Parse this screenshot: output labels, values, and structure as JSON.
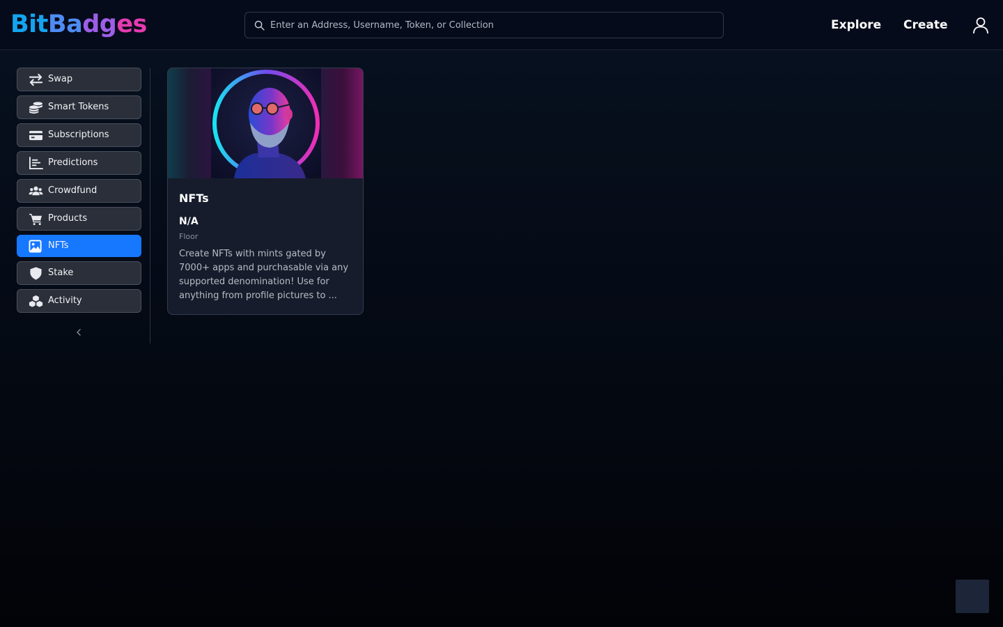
{
  "header": {
    "logo": {
      "part1": "Bit",
      "part2": "Ba",
      "part3": "dg",
      "part4": "es"
    },
    "search": {
      "placeholder": "Enter an Address, Username, Token, or Collection",
      "value": "",
      "icon": "search-icon"
    },
    "nav": {
      "explore": "Explore",
      "create": "Create"
    },
    "user_icon": "user-icon"
  },
  "sidebar": {
    "items": [
      {
        "label": "Swap",
        "icon": "swap-icon",
        "active": false
      },
      {
        "label": "Smart Tokens",
        "icon": "coins-icon",
        "active": false
      },
      {
        "label": "Subscriptions",
        "icon": "credit-card-icon",
        "active": false
      },
      {
        "label": "Predictions",
        "icon": "bar-chart-icon",
        "active": false
      },
      {
        "label": "Crowdfund",
        "icon": "users-icon",
        "active": false
      },
      {
        "label": "Products",
        "icon": "cart-icon",
        "active": false
      },
      {
        "label": "NFTs",
        "icon": "image-icon",
        "active": true
      },
      {
        "label": "Stake",
        "icon": "shield-icon",
        "active": false
      },
      {
        "label": "Activity",
        "icon": "cubes-icon",
        "active": false
      }
    ],
    "collapse_icon": "chevron-left-icon"
  },
  "card": {
    "title": "NFTs",
    "value": "N/A",
    "value_label": "Floor",
    "description": "Create NFTs with mints gated by 7000+ apps and purchasable via any supported denomination! Use for anything from profile pictures to collectibles and more."
  },
  "colors": {
    "accent": "#1677ff",
    "header_bg": "#060b1b",
    "sidebar_item_bg": "#2a2f3a",
    "card_bg": "#161c2b"
  }
}
